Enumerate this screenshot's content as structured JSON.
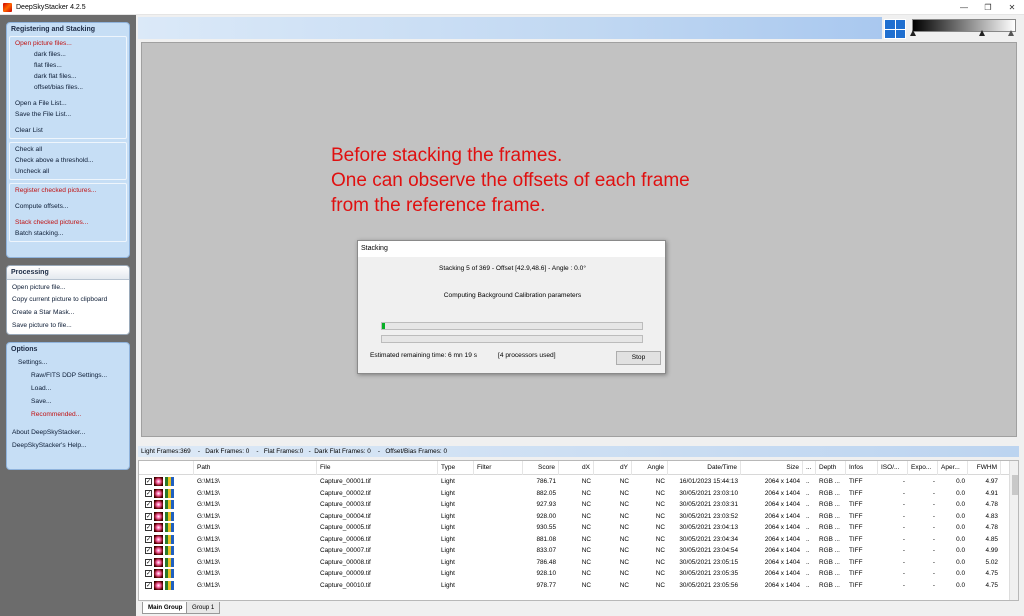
{
  "window": {
    "title": "DeepSkyStacker 4.2.5",
    "buttons": [
      "—",
      "❐",
      "✕"
    ]
  },
  "sidebar": {
    "registering": {
      "header": "Registering and Stacking",
      "open_picture_files": "Open picture files...",
      "dark_files": "dark files...",
      "flat_files": "flat files...",
      "dark_flat_files": "dark flat files...",
      "offset_bias_files": "offset/bias files...",
      "open_file_list": "Open a File List...",
      "save_file_list": "Save the File List...",
      "clear_list": "Clear List",
      "check_all": "Check all",
      "check_above_threshold": "Check above a threshold...",
      "uncheck_all": "Uncheck all",
      "register_checked": "Register checked pictures...",
      "compute_offsets": "Compute offsets...",
      "stack_checked": "Stack checked pictures...",
      "batch_stacking": "Batch stacking..."
    },
    "processing": {
      "header": "Processing",
      "open_picture_file": "Open picture file...",
      "copy_to_clipboard": "Copy current picture to clipboard",
      "create_star_mask": "Create a Star Mask...",
      "save_picture": "Save picture to file..."
    },
    "options": {
      "header": "Options",
      "settings": "Settings...",
      "raw_fits": "Raw/FITS DDP Settings...",
      "load": "Load...",
      "save": "Save...",
      "recommended": "Recommended...",
      "about": "About DeepSkyStacker...",
      "help": "DeepSkyStacker's Help..."
    }
  },
  "annotation": {
    "line1": "Before stacking the frames.",
    "line2": "One can observe the offsets of each frame",
    "line3": "from the reference frame."
  },
  "dialog": {
    "title": "Stacking",
    "progress_line": "Stacking 5 of 369 - Offset [42.9,48.6] - Angle : 0.0°",
    "step_line": "Computing Background Calibration parameters",
    "progress1": 0.012,
    "progress2": 0.0,
    "remaining": "Estimated remaining time: 6 mn 19 s",
    "processors": "[4 processors used]",
    "stop_label": "Stop"
  },
  "status": {
    "text": "Light Frames:369    -   Dark Frames: 0    -   Flat Frames:0   -  Dark Flat Frames: 0    -   Offset/Bias Frames: 0"
  },
  "table": {
    "columns": [
      "Path",
      "File",
      "Type",
      "Filter",
      "Score",
      "dX",
      "dY",
      "Angle",
      "Date/Time",
      "Size",
      "...",
      "Depth",
      "Infos",
      "ISO/...",
      "Expo...",
      "Aper...",
      "FWHM"
    ],
    "rows": [
      {
        "path": "G:\\M13\\",
        "file": "Capture_00001.tif",
        "type": "Light",
        "score": "786.71",
        "dx": "NC",
        "dy": "NC",
        "angle": "NC",
        "date": "16/01/2023 15:44:13",
        "size": "2064 x 1404",
        "dots": "..",
        "depth": "RGB ...",
        "infos": "TIFF",
        "iso": "-",
        "expo": "-",
        "aper": "0.0",
        "fwhm": "4.97"
      },
      {
        "path": "G:\\M13\\",
        "file": "Capture_00002.tif",
        "type": "Light",
        "score": "882.05",
        "dx": "NC",
        "dy": "NC",
        "angle": "NC",
        "date": "30/05/2021 23:03:10",
        "size": "2064 x 1404",
        "dots": "..",
        "depth": "RGB ...",
        "infos": "TIFF",
        "iso": "-",
        "expo": "-",
        "aper": "0.0",
        "fwhm": "4.91"
      },
      {
        "path": "G:\\M13\\",
        "file": "Capture_00003.tif",
        "type": "Light",
        "score": "927.93",
        "dx": "NC",
        "dy": "NC",
        "angle": "NC",
        "date": "30/05/2021 23:03:31",
        "size": "2064 x 1404",
        "dots": "..",
        "depth": "RGB ...",
        "infos": "TIFF",
        "iso": "-",
        "expo": "-",
        "aper": "0.0",
        "fwhm": "4.78"
      },
      {
        "path": "G:\\M13\\",
        "file": "Capture_00004.tif",
        "type": "Light",
        "score": "928.00",
        "dx": "NC",
        "dy": "NC",
        "angle": "NC",
        "date": "30/05/2021 23:03:52",
        "size": "2064 x 1404",
        "dots": "..",
        "depth": "RGB ...",
        "infos": "TIFF",
        "iso": "-",
        "expo": "-",
        "aper": "0.0",
        "fwhm": "4.83"
      },
      {
        "path": "G:\\M13\\",
        "file": "Capture_00005.tif",
        "type": "Light",
        "score": "930.55",
        "dx": "NC",
        "dy": "NC",
        "angle": "NC",
        "date": "30/05/2021 23:04:13",
        "size": "2064 x 1404",
        "dots": "..",
        "depth": "RGB ...",
        "infos": "TIFF",
        "iso": "-",
        "expo": "-",
        "aper": "0.0",
        "fwhm": "4.78"
      },
      {
        "path": "G:\\M13\\",
        "file": "Capture_00006.tif",
        "type": "Light",
        "score": "881.08",
        "dx": "NC",
        "dy": "NC",
        "angle": "NC",
        "date": "30/05/2021 23:04:34",
        "size": "2064 x 1404",
        "dots": "..",
        "depth": "RGB ...",
        "infos": "TIFF",
        "iso": "-",
        "expo": "-",
        "aper": "0.0",
        "fwhm": "4.85"
      },
      {
        "path": "G:\\M13\\",
        "file": "Capture_00007.tif",
        "type": "Light",
        "score": "833.07",
        "dx": "NC",
        "dy": "NC",
        "angle": "NC",
        "date": "30/05/2021 23:04:54",
        "size": "2064 x 1404",
        "dots": "..",
        "depth": "RGB ...",
        "infos": "TIFF",
        "iso": "-",
        "expo": "-",
        "aper": "0.0",
        "fwhm": "4.99"
      },
      {
        "path": "G:\\M13\\",
        "file": "Capture_00008.tif",
        "type": "Light",
        "score": "786.48",
        "dx": "NC",
        "dy": "NC",
        "angle": "NC",
        "date": "30/05/2021 23:05:15",
        "size": "2064 x 1404",
        "dots": "..",
        "depth": "RGB ...",
        "infos": "TIFF",
        "iso": "-",
        "expo": "-",
        "aper": "0.0",
        "fwhm": "5.02"
      },
      {
        "path": "G:\\M13\\",
        "file": "Capture_00009.tif",
        "type": "Light",
        "score": "928.10",
        "dx": "NC",
        "dy": "NC",
        "angle": "NC",
        "date": "30/05/2021 23:05:35",
        "size": "2064 x 1404",
        "dots": "..",
        "depth": "RGB ...",
        "infos": "TIFF",
        "iso": "-",
        "expo": "-",
        "aper": "0.0",
        "fwhm": "4.75"
      },
      {
        "path": "G:\\M13\\",
        "file": "Capture_00010.tif",
        "type": "Light",
        "score": "978.77",
        "dx": "NC",
        "dy": "NC",
        "angle": "NC",
        "date": "30/05/2021 23:05:56",
        "size": "2064 x 1404",
        "dots": "..",
        "depth": "RGB ...",
        "infos": "TIFF",
        "iso": "-",
        "expo": "-",
        "aper": "0.0",
        "fwhm": "4.75"
      }
    ]
  },
  "tabs": [
    "Main Group",
    "Group 1"
  ],
  "colors": {
    "annotation": "#e01010",
    "progress": "#06b025",
    "sidebar_panel": "#c6def5",
    "sidebar_bg": "#6c6c6c",
    "red_item": "#c01010"
  },
  "icons": {
    "app": "dss-app-icon",
    "checkbox": "checkbox-checked-icon",
    "thumbnail": "star-thumbnail-icon",
    "color_channels": "rgb-channels-icon"
  }
}
